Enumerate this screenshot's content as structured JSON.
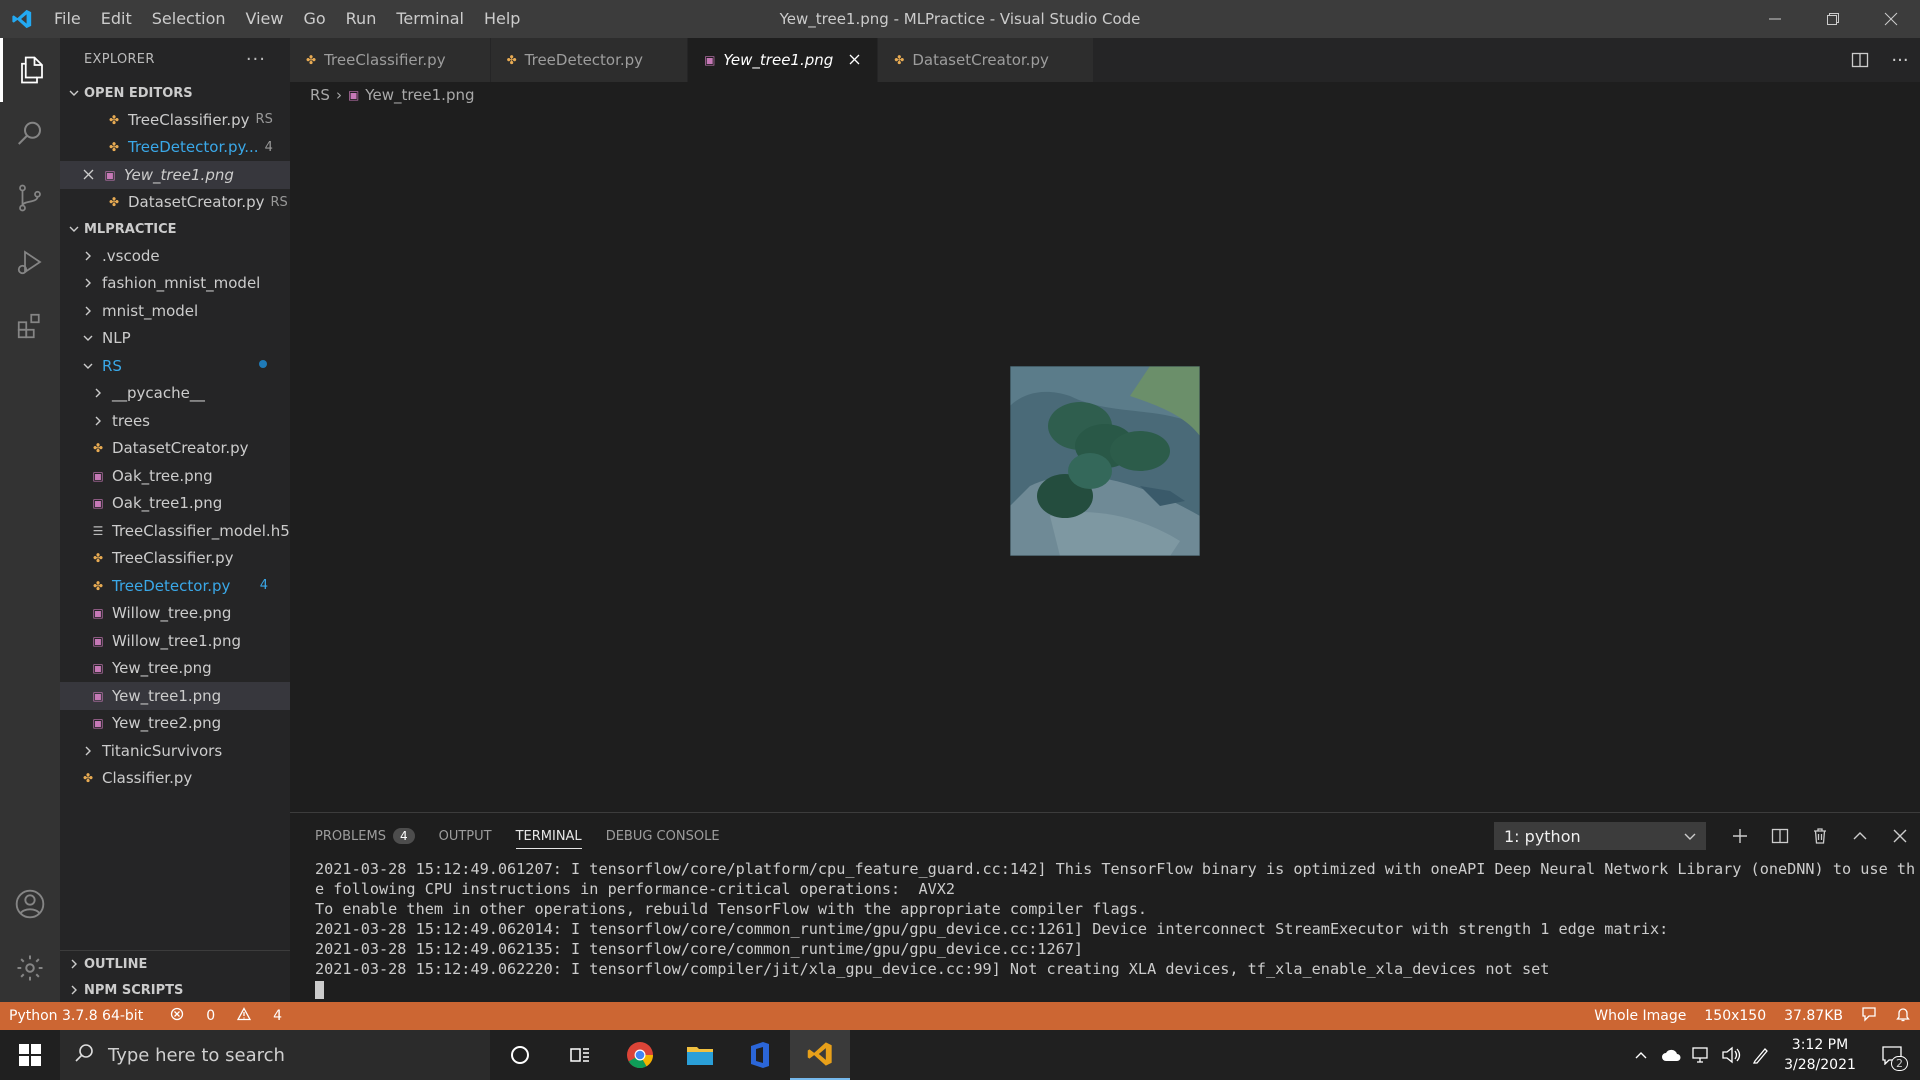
{
  "titlebar": {
    "menu": [
      "File",
      "Edit",
      "Selection",
      "View",
      "Go",
      "Run",
      "Terminal",
      "Help"
    ],
    "title": "Yew_tree1.png - MLPractice - Visual Studio Code"
  },
  "sidebar": {
    "header": "EXPLORER",
    "open_editors_title": "OPEN EDITORS",
    "open_editors": [
      {
        "name": "TreeClassifier.py",
        "suffix": "RS",
        "type": "py"
      },
      {
        "name": "TreeDetector.py...",
        "suffix": "4",
        "type": "py",
        "warn": true
      },
      {
        "name": "Yew_tree1.png",
        "suffix": "",
        "type": "png",
        "active": true
      },
      {
        "name": "DatasetCreator.py",
        "suffix": "RS",
        "type": "py"
      }
    ],
    "project_title": "MLPRACTICE",
    "tree": [
      {
        "name": ".vscode",
        "kind": "folder",
        "depth": 1
      },
      {
        "name": "fashion_mnist_model",
        "kind": "folder",
        "depth": 1
      },
      {
        "name": "mnist_model",
        "kind": "folder",
        "depth": 1
      },
      {
        "name": "NLP",
        "kind": "folder-open",
        "depth": 1
      },
      {
        "name": "RS",
        "kind": "folder-open",
        "depth": 1,
        "warn": true,
        "dot": true
      },
      {
        "name": "__pycache__",
        "kind": "folder",
        "depth": 2
      },
      {
        "name": "trees",
        "kind": "folder",
        "depth": 2
      },
      {
        "name": "DatasetCreator.py",
        "kind": "py",
        "depth": 2
      },
      {
        "name": "Oak_tree.png",
        "kind": "png",
        "depth": 2
      },
      {
        "name": "Oak_tree1.png",
        "kind": "png",
        "depth": 2
      },
      {
        "name": "TreeClassifier_model.h5",
        "kind": "file",
        "depth": 2
      },
      {
        "name": "TreeClassifier.py",
        "kind": "py",
        "depth": 2
      },
      {
        "name": "TreeDetector.py",
        "kind": "py",
        "depth": 2,
        "warn": true,
        "badge": "4"
      },
      {
        "name": "Willow_tree.png",
        "kind": "png",
        "depth": 2
      },
      {
        "name": "Willow_tree1.png",
        "kind": "png",
        "depth": 2
      },
      {
        "name": "Yew_tree.png",
        "kind": "png",
        "depth": 2
      },
      {
        "name": "Yew_tree1.png",
        "kind": "png",
        "depth": 2,
        "selected": true
      },
      {
        "name": "Yew_tree2.png",
        "kind": "png",
        "depth": 2
      },
      {
        "name": "TitanicSurvivors",
        "kind": "folder",
        "depth": 1
      },
      {
        "name": "Classifier.py",
        "kind": "py",
        "depth": 1
      }
    ],
    "outline": "OUTLINE",
    "npm": "NPM SCRIPTS"
  },
  "tabs": [
    {
      "label": "TreeClassifier.py",
      "type": "py"
    },
    {
      "label": "TreeDetector.py",
      "type": "py"
    },
    {
      "label": "Yew_tree1.png",
      "type": "png",
      "active": true
    },
    {
      "label": "DatasetCreator.py",
      "type": "py"
    }
  ],
  "breadcrumb": {
    "folder": "RS",
    "file": "Yew_tree1.png"
  },
  "panel": {
    "tabs": [
      "PROBLEMS",
      "OUTPUT",
      "TERMINAL",
      "DEBUG CONSOLE"
    ],
    "problems_count": "4",
    "terminal_select": "1: python",
    "lines": [
      "2021-03-28 15:12:49.061207: I tensorflow/core/platform/cpu_feature_guard.cc:142] This TensorFlow binary is optimized with oneAPI Deep Neural Network Library (oneDNN) to use th",
      "e following CPU instructions in performance-critical operations:  AVX2",
      "To enable them in other operations, rebuild TensorFlow with the appropriate compiler flags.",
      "2021-03-28 15:12:49.062014: I tensorflow/core/common_runtime/gpu/gpu_device.cc:1261] Device interconnect StreamExecutor with strength 1 edge matrix:",
      "2021-03-28 15:12:49.062135: I tensorflow/core/common_runtime/gpu/gpu_device.cc:1267]",
      "2021-03-28 15:12:49.062220: I tensorflow/compiler/jit/xla_gpu_device.cc:99] Not creating XLA devices, tf_xla_enable_xla_devices not set"
    ]
  },
  "statusbar": {
    "python": "Python 3.7.8 64-bit",
    "errors": "0",
    "warnings": "4",
    "zoom": "Whole Image",
    "dimensions": "150x150",
    "filesize": "37.87KB"
  },
  "taskbar": {
    "search_placeholder": "Type here to search",
    "time": "3:12 PM",
    "date": "3/28/2021",
    "notifications": "2"
  },
  "colors": {
    "statusbar": "#cc6633",
    "accent": "#007acc"
  }
}
